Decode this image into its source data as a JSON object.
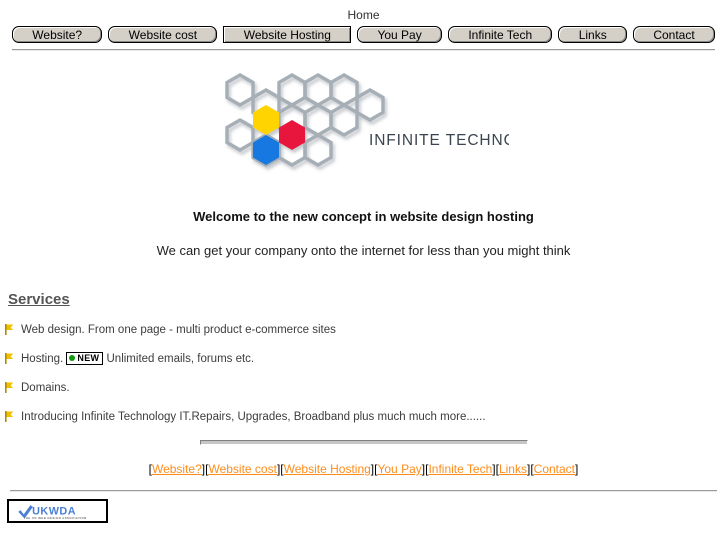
{
  "page": {
    "home_label": "Home"
  },
  "nav": {
    "items": [
      {
        "label": "Website?",
        "current": false
      },
      {
        "label": "Website cost",
        "current": false
      },
      {
        "label": "Website Hosting",
        "current": true
      },
      {
        "label": "You Pay",
        "current": false
      },
      {
        "label": "Infinite Tech",
        "current": false
      },
      {
        "label": "Links",
        "current": false
      },
      {
        "label": "Contact",
        "current": false
      }
    ]
  },
  "logo": {
    "company_name": "INFINITE TECHNOLOGY",
    "hex_colors": {
      "yellow": "#ffd400",
      "red": "#e8143c",
      "blue": "#1878e0",
      "outline": "#9aa3ad"
    }
  },
  "main": {
    "heading": "Welcome to the new concept in website design hosting",
    "subheading": "We can get your company onto the internet for less than you might think",
    "services_title": "Services",
    "services": [
      {
        "text": "Web design. From one page - multi product e-commerce sites",
        "badge": null,
        "text_after": ""
      },
      {
        "text": "Hosting.",
        "badge": "NEW",
        "text_after": "Unlimited emails, forums etc."
      },
      {
        "text": "Domains.",
        "badge": null,
        "text_after": ""
      },
      {
        "text": "Introducing Infinite Technology IT.Repairs, Upgrades, Broadband plus much much more......",
        "badge": null,
        "text_after": ""
      }
    ]
  },
  "footer": {
    "open_bracket": "[",
    "close_bracket": "]",
    "links": [
      "Website?",
      "Website cost",
      "Website Hosting",
      "You Pay",
      "Infinite Tech",
      "Links",
      "Contact"
    ],
    "link_color": "#ff8c1a"
  },
  "badge": {
    "name": "UKWDA",
    "tagline": "THE UK WEB DESIGN ASSOCIATION",
    "color": "#4a7fd4"
  }
}
